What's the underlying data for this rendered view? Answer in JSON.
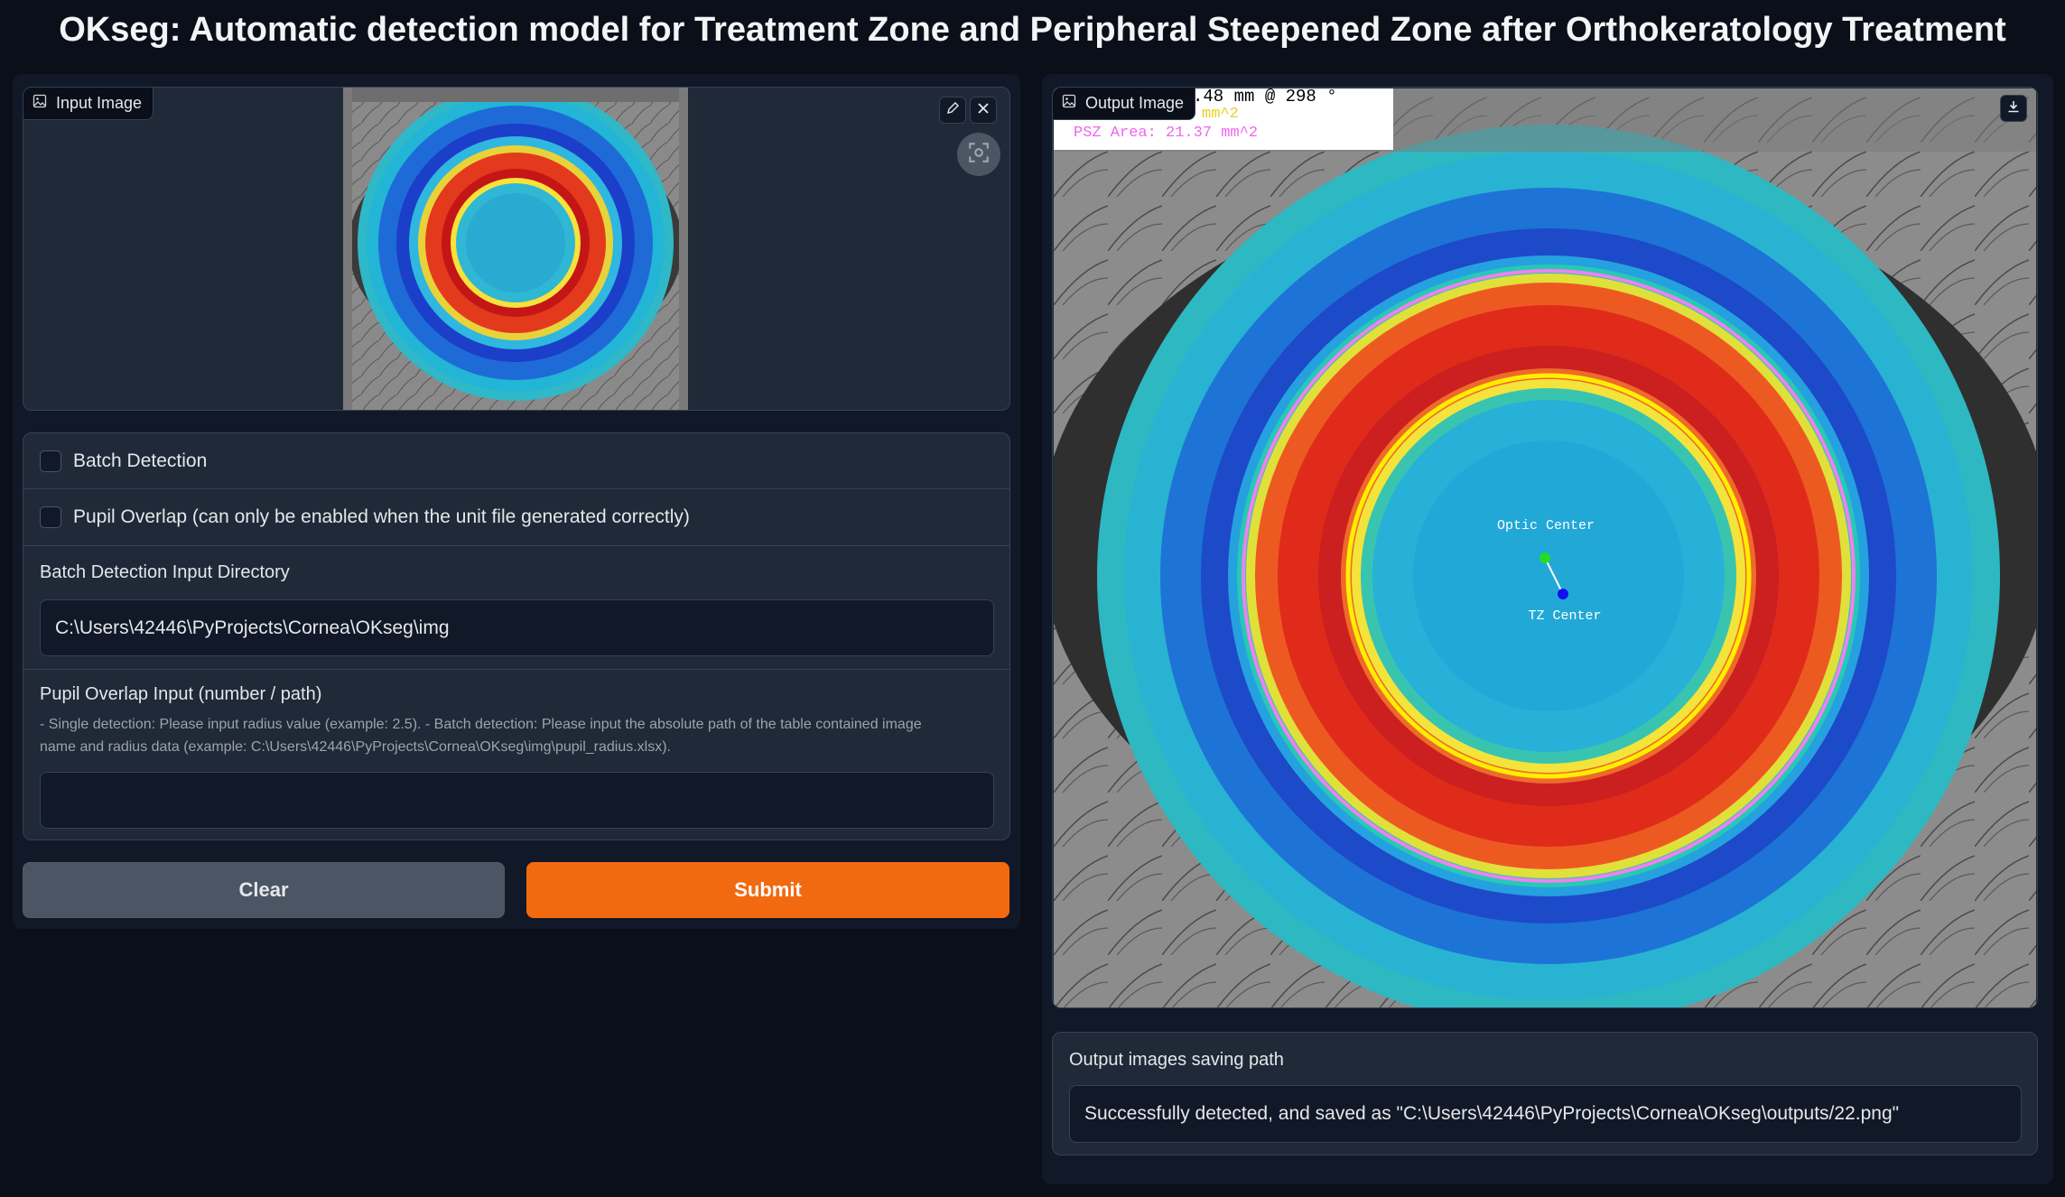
{
  "title": "OKseg: Automatic detection model for Treatment Zone and Peripheral Steepened Zone after Orthokeratology Treatment",
  "input_image": {
    "label": "Input Image",
    "edit_icon": "pencil-icon",
    "close_icon": "close-icon",
    "focus_icon": "focus-scan-icon"
  },
  "options": {
    "batch_detection": {
      "label": "Batch Detection",
      "checked": false
    },
    "pupil_overlap": {
      "label": "Pupil Overlap (can only be enabled when the unit file generated correctly)",
      "checked": false
    }
  },
  "batch_dir": {
    "label": "Batch Detection Input Directory",
    "value": "C:\\Users\\42446\\PyProjects\\Cornea\\OKseg\\img"
  },
  "pupil_input": {
    "label": "Pupil Overlap Input (number / path)",
    "info_line1": "- Single detection: Please input radius value (example: 2.5). - Batch detection: Please input the absolute path of the table contained image",
    "info_line2": "name and radius data (example: C:\\Users\\42446\\PyProjects\\Cornea\\OKseg\\img\\pupil_radius.xlsx).",
    "value": ""
  },
  "buttons": {
    "clear": "Clear",
    "submit": "Submit"
  },
  "output_image": {
    "label": "Output Image",
    "download_icon": "download-icon",
    "overlay_line1": ".48 mm @ 298 °",
    "overlay_line2": "mm^2",
    "overlay_line3": "PSZ Area: 21.37 mm^2",
    "optic_center_label": "Optic Center",
    "tz_center_label": "TZ Center"
  },
  "output_path": {
    "label": "Output images saving path",
    "value": "Successfully detected, and saved as \"C:\\Users\\42446\\PyProjects\\Cornea\\OKseg\\outputs/22.png\""
  },
  "colors": {
    "background": "#0b0f19",
    "panel": "#1f2937",
    "submit": "#f97316",
    "clear": "#4b5563",
    "psz_magenta": "#ee82ee",
    "tz_yellow": "#ffee00"
  }
}
